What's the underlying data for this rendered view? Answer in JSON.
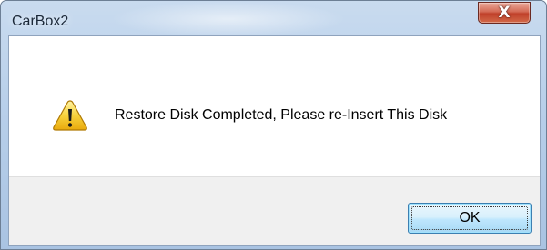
{
  "window": {
    "title": "CarBox2",
    "close_glyph": "X"
  },
  "message": {
    "icon": "warning-icon",
    "text": "Restore Disk Completed, Please re-Insert This Disk"
  },
  "buttons": {
    "ok_label": "OK"
  },
  "colors": {
    "title_bar": "#b9d0ea",
    "close_button": "#c0402a",
    "content_background": "#ffffff",
    "button_bar_background": "#f0f0f0",
    "ok_button_border": "#3c7fb1",
    "warning_icon": "#f2c21b"
  }
}
